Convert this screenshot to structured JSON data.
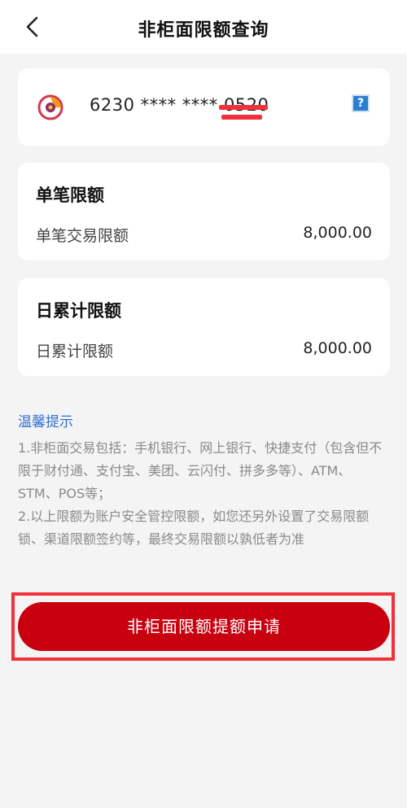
{
  "header": {
    "title": "非柜面限额查询"
  },
  "account": {
    "number": "6230 **** **** 0520"
  },
  "single_limit": {
    "title": "单笔限额",
    "label": "单笔交易限额",
    "value": "8,000.00"
  },
  "daily_limit": {
    "title": "日累计限额",
    "label": "日累计限额",
    "value": "8,000.00"
  },
  "tips": {
    "title": "温馨提示",
    "line1": "1.非柜面交易包括：手机银行、网上银行、快捷支付（包含但不限于财付通、支付宝、美团、云闪付、拼多多等）、ATM、STM、POS等；",
    "line2": "2.以上限额为账户安全管控限额，如您还另外设置了交易限额锁、渠道限额签约等，最终交易限额以孰低者为准"
  },
  "apply_button": {
    "label": "非柜面限额提额申请"
  },
  "help_icon": {
    "glyph": "?"
  },
  "colors": {
    "accent": "#c8000f",
    "link": "#2f6fd6",
    "highlight": "#f0313b"
  }
}
